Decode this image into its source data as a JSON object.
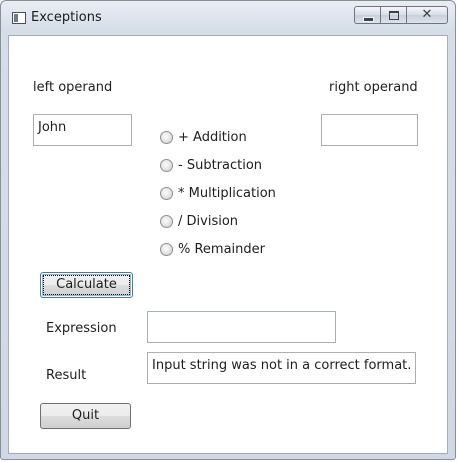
{
  "window": {
    "title": "Exceptions",
    "caption_buttons": {
      "minimize": "minimize",
      "maximize": "maximize",
      "close": "✕"
    }
  },
  "form": {
    "left_operand_label": "left operand",
    "right_operand_label": "right operand",
    "left_operand_value": "John",
    "right_operand_value": "",
    "operators": [
      {
        "label": "+ Addition",
        "checked": false
      },
      {
        "label": "- Subtraction",
        "checked": false
      },
      {
        "label": "* Multiplication",
        "checked": false
      },
      {
        "label": "/ Division",
        "checked": false
      },
      {
        "label": "% Remainder",
        "checked": false
      }
    ],
    "calculate_label": "Calculate",
    "expression_label": "Expression",
    "expression_value": "",
    "result_label": "Result",
    "result_value": "Input string was not in a correct format.",
    "quit_label": "Quit"
  }
}
